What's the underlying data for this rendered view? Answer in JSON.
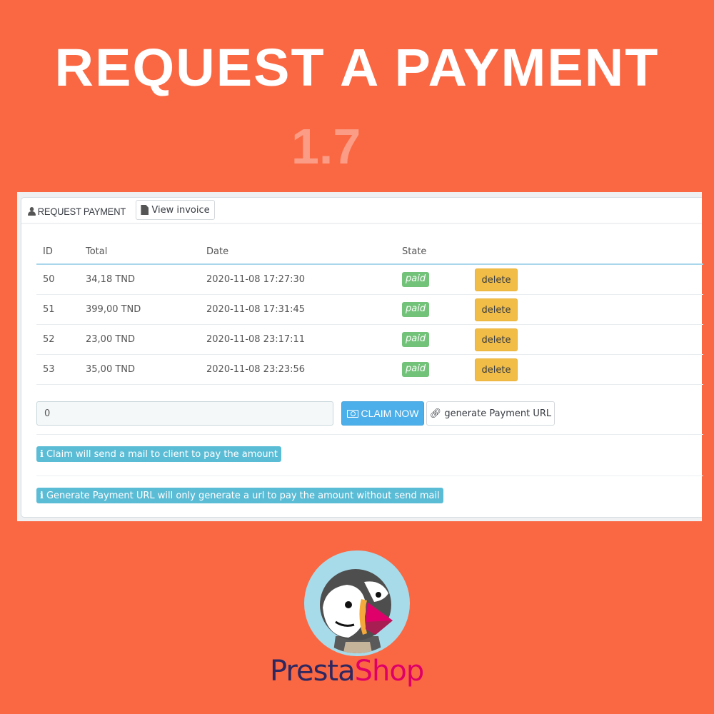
{
  "hero": {
    "title": "REQUEST A PAYMENT",
    "version": "1.7"
  },
  "panel": {
    "title": "REQUEST PAYMENT",
    "title_icon": "user-icon",
    "view_invoice_label": "View invoice",
    "view_invoice_icon": "file-icon"
  },
  "table": {
    "columns": [
      "ID",
      "Total",
      "Date",
      "State",
      ""
    ],
    "rows": [
      {
        "id": "50",
        "total": "34,18 TND",
        "date": "2020-11-08 17:27:30",
        "state": "paid",
        "action": "delete"
      },
      {
        "id": "51",
        "total": "399,00 TND",
        "date": "2020-11-08 17:31:45",
        "state": "paid",
        "action": "delete"
      },
      {
        "id": "52",
        "total": "23,00 TND",
        "date": "2020-11-08 23:17:11",
        "state": "paid",
        "action": "delete"
      },
      {
        "id": "53",
        "total": "35,00 TND",
        "date": "2020-11-08 23:23:56",
        "state": "paid",
        "action": "delete"
      }
    ]
  },
  "claim": {
    "amount_value": "0",
    "claim_label": "CLAIM NOW",
    "claim_icon": "money-icon",
    "generate_label": "generate Payment URL",
    "generate_icon": "link-icon"
  },
  "info": {
    "claim_note": "Claim will send a mail to client to pay the amount",
    "generate_note": "Generate Payment URL will only generate a url to pay the amount without send mail"
  },
  "brand": {
    "part1": "Presta",
    "part2": "Shop"
  },
  "colors": {
    "background": "#fa6843",
    "paid_badge": "#72c279",
    "delete_button": "#f1bd46",
    "claim_button": "#4dafe9",
    "info_pill": "#5bbcd6",
    "brand_dark": "#2e2760",
    "brand_pink": "#df0067"
  }
}
